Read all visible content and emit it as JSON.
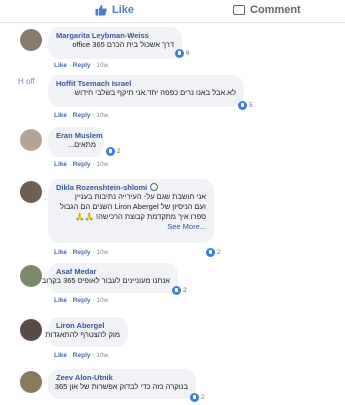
{
  "actions": {
    "like": "Like",
    "comment": "Comment"
  },
  "meta": {
    "like": "Like",
    "reply": "Reply",
    "time": "10w",
    "sep": " · "
  },
  "colors": {
    "link": "#385898",
    "bubble": "#f0f2f5",
    "react": "#3b7de0"
  },
  "comments": [
    {
      "author": "Margarita Leybman-Weiss",
      "lines": [
        "דרך אשכול בית הכרם office 365"
      ],
      "reactions": "6"
    },
    {
      "author": "Hoffit Tsemach Israel",
      "avatar_alt": "H off",
      "lines": [
        "לא.אבל באנו נרים כפפה יחד.אני תיקף בשלבי חידוש"
      ],
      "reactions": "5"
    },
    {
      "author": "Eran Muslem",
      "lines": [
        "מתאים..."
      ],
      "reactions": "2"
    },
    {
      "author": "Dikla Rozenshtein-shlomi",
      "lines": [
        "אני חושבת שגם על- העירייה נתיבות בעניין",
        "ועם הניסיון של Liron Abergel השנים הם הגבול",
        "ספרו איך מתקדמת קבוצת הרכישה! 🙏🙏"
      ],
      "see_more": "See More...",
      "reactions": "2"
    },
    {
      "author": "Asaf Medar",
      "lines": [
        "אנחנו מעוניינים לעבור לאופיס 365 בקרוב"
      ],
      "reactions": "2"
    },
    {
      "author": "Liron Abergel",
      "lines": [
        "מוק להצטרף להתאגדות"
      ],
      "reactions": ""
    },
    {
      "author": "Zeev Alon-Utnik",
      "lines": [
        "בנוקרה כזה כדי לבדוק אפשרות של און 365"
      ],
      "reactions": "2"
    }
  ]
}
